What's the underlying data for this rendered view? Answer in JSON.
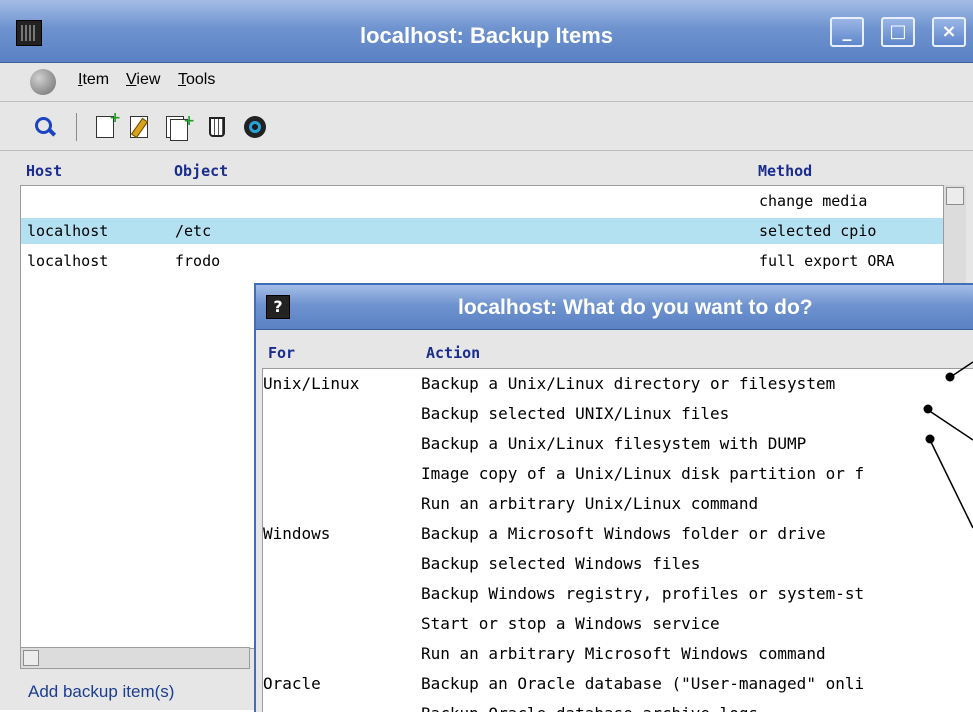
{
  "window": {
    "title": "localhost: Backup Items",
    "minimize_glyph": "_",
    "maximize_glyph": "□",
    "close_glyph": "×"
  },
  "menu": {
    "items": [
      "Item",
      "View",
      "Tools"
    ]
  },
  "toolbar": {
    "icons": [
      "search-icon",
      "new-item-icon",
      "edit-item-icon",
      "copy-item-icon",
      "trash-icon",
      "view-icon"
    ]
  },
  "list": {
    "headers": {
      "host": "Host",
      "object": "Object",
      "method": "Method"
    },
    "rows": [
      {
        "host": "",
        "object": "",
        "method": "change media"
      },
      {
        "host": "localhost",
        "object": "/etc",
        "method": "selected cpio"
      },
      {
        "host": "localhost",
        "object": "frodo",
        "method": "full export ORA"
      }
    ],
    "selected_index": 1
  },
  "add_button": "Add backup item(s)",
  "dialog": {
    "title": "localhost: What do you want to do?",
    "icon_glyph": "?",
    "headers": {
      "for": "For",
      "action": "Action"
    },
    "rows": [
      {
        "for": "Unix/Linux",
        "action": "Backup a Unix/Linux directory or filesystem"
      },
      {
        "for": "",
        "action": "Backup selected UNIX/Linux files"
      },
      {
        "for": "",
        "action": "Backup a Unix/Linux filesystem with DUMP"
      },
      {
        "for": "",
        "action": "Image copy of a Unix/Linux disk partition or f"
      },
      {
        "for": "",
        "action": "Run an arbitrary Unix/Linux command"
      },
      {
        "for": "Windows",
        "action": "Backup a Microsoft Windows folder or drive"
      },
      {
        "for": "",
        "action": "Backup selected Windows files"
      },
      {
        "for": "",
        "action": "Backup Windows registry, profiles or system-st"
      },
      {
        "for": "",
        "action": "Start or stop a Windows service"
      },
      {
        "for": "",
        "action": "Run an arbitrary Microsoft Windows command"
      },
      {
        "for": "Oracle",
        "action": "Backup an Oracle database (\"User-managed\" onli"
      },
      {
        "for": "",
        "action": "Backup Oracle database archive logs"
      }
    ]
  },
  "colors": {
    "title_gradient": "#6f93cf",
    "header_text": "#1a2c8c",
    "selection": "#b4e1f1",
    "link_text": "#1b3d8f"
  }
}
